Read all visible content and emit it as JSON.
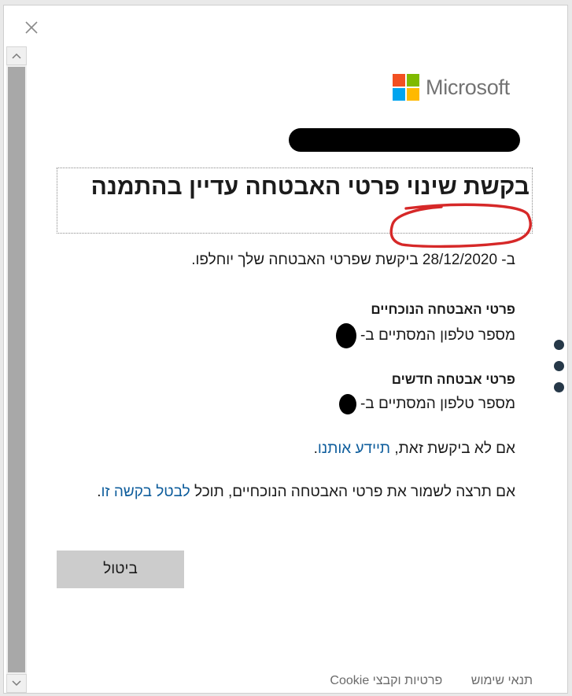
{
  "brand": {
    "name": "Microsoft",
    "logo_colors": [
      "#f25022",
      "#7fba00",
      "#00a4ef",
      "#ffb900"
    ]
  },
  "heading": "בקשת שינוי פרטי האבטחה עדיין בהתמנה",
  "requested_text": "ב- 28/12/2020 ביקשת שפרטי האבטחה שלך יוחלפו.",
  "current": {
    "title": "פרטי האבטחה הנוכחיים",
    "value": "מספר טלפון המסתיים ב-"
  },
  "new_info": {
    "title": "פרטי אבטחה חדשים",
    "value": "מספר טלפון המסתיים ב-"
  },
  "not_you": {
    "prefix": "אם לא ביקשת זאת,",
    "link": "תיידע אותנו",
    "suffix": "."
  },
  "keep": {
    "prefix": "אם תרצה לשמור את פרטי האבטחה הנוכחיים, תוכל",
    "link": "לבטל בקשה זו",
    "suffix": "."
  },
  "cancel_label": "ביטול",
  "footer": {
    "terms": "תנאי שימוש",
    "privacy": "פרטיות וקבצי Cookie"
  },
  "colors": {
    "link": "#0e5d9c",
    "annotation": "#d62828",
    "button": "#cccccc"
  }
}
